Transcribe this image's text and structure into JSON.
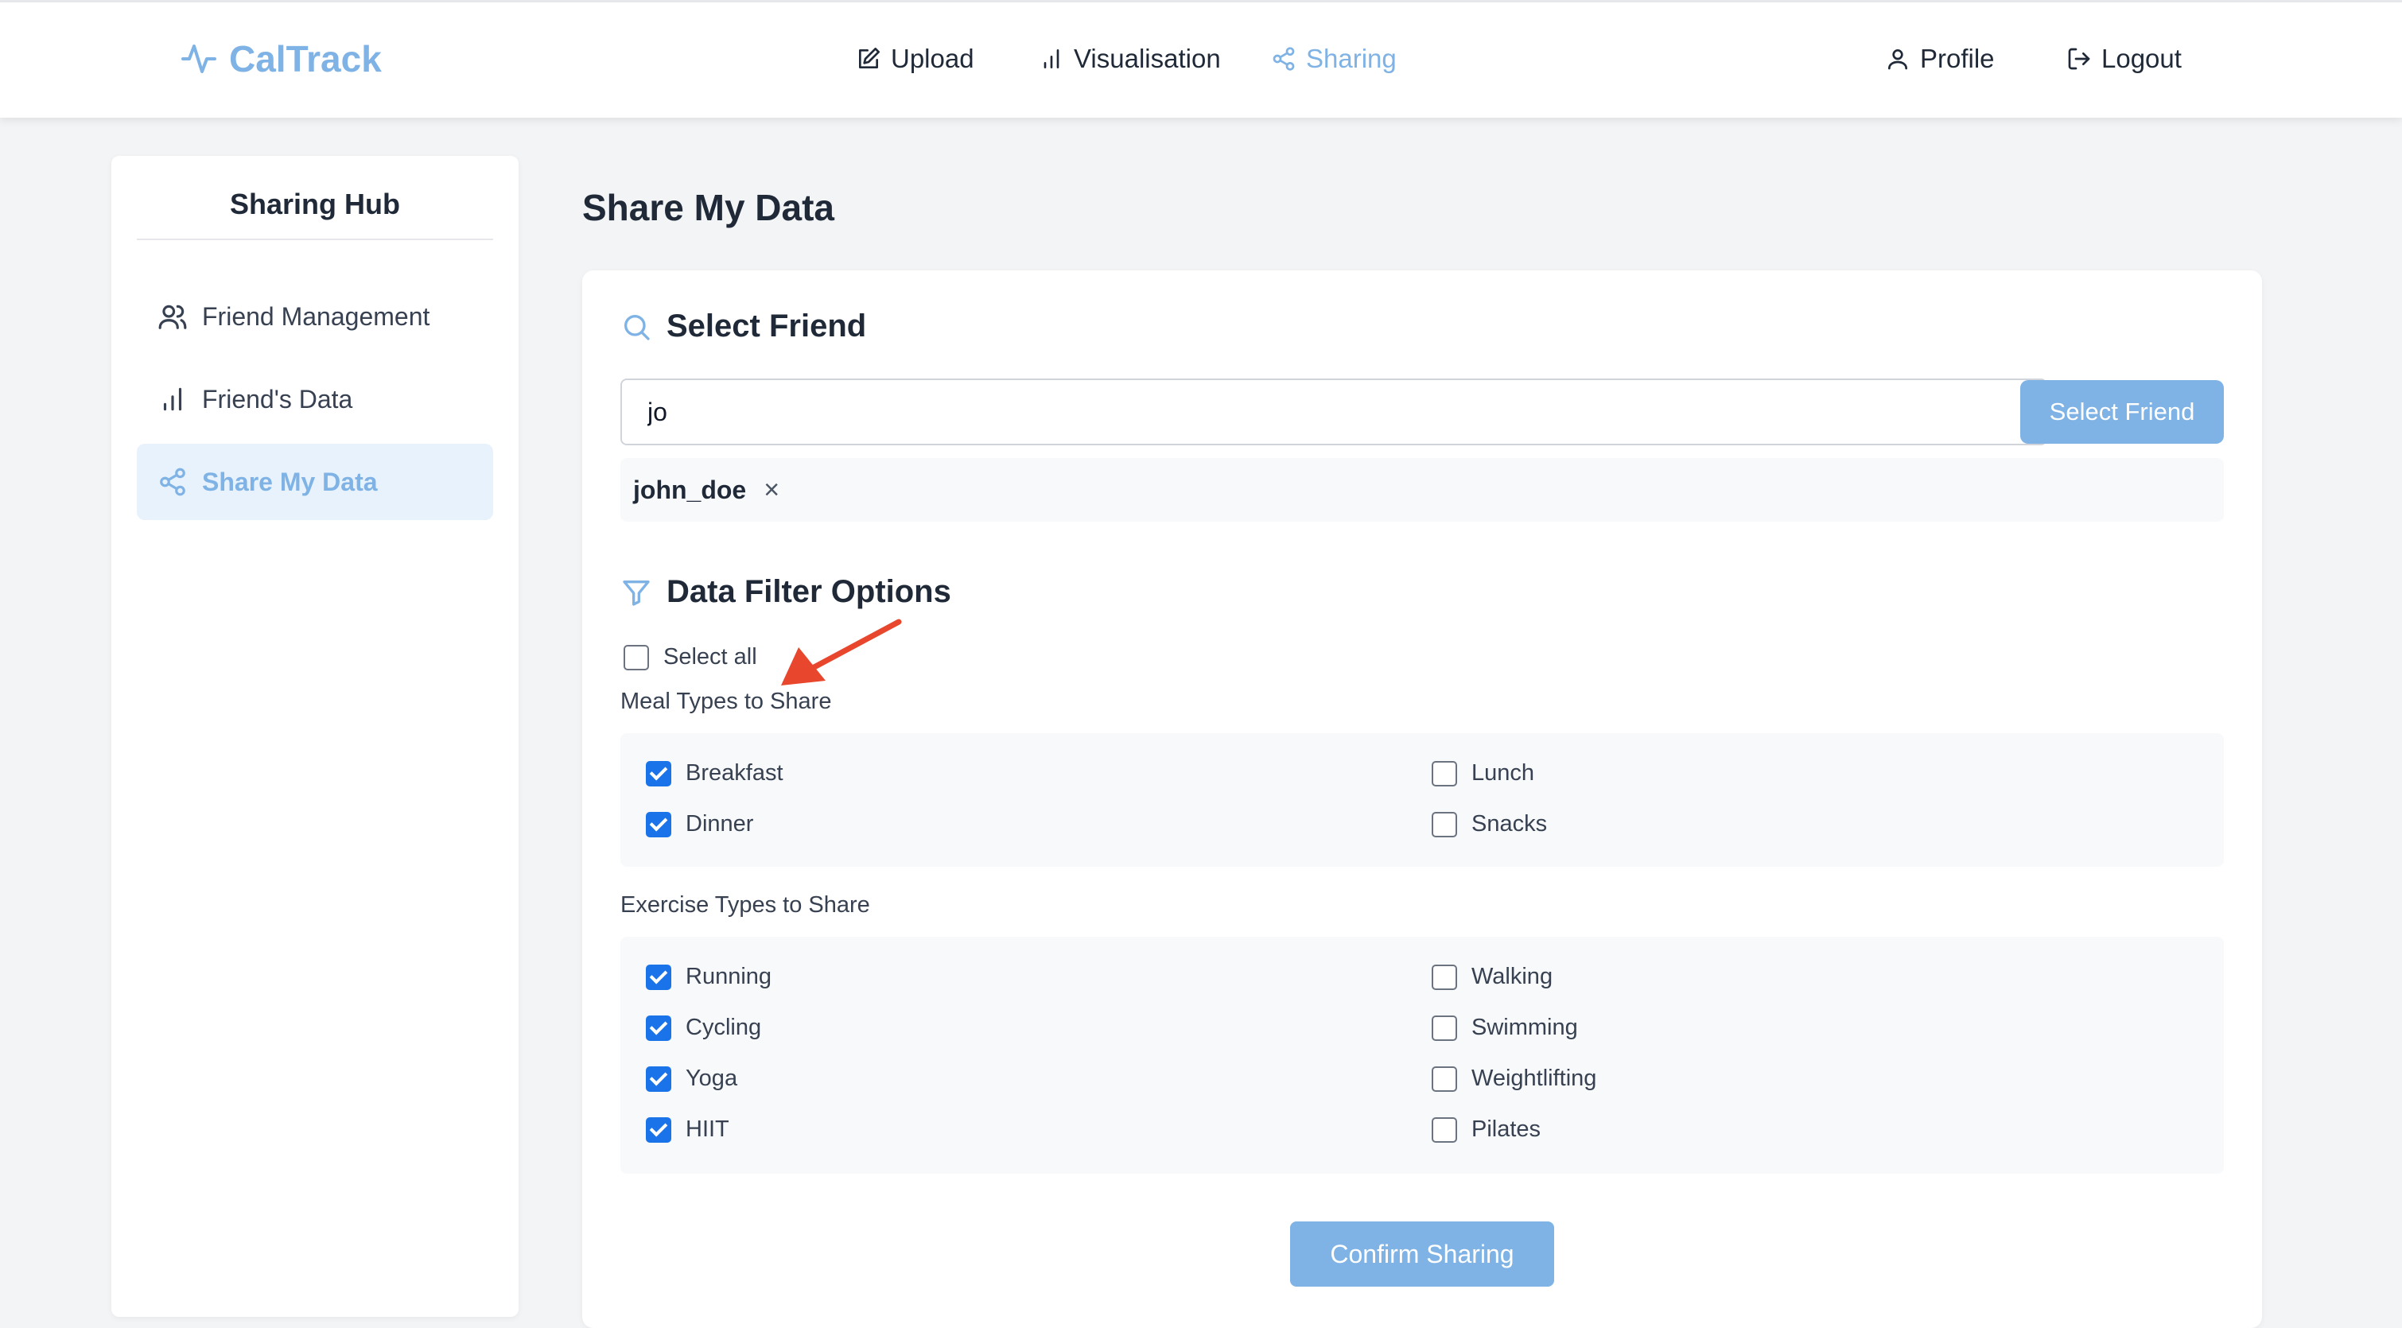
{
  "app": {
    "name": "CalTrack",
    "accent": "#7fb2e5"
  },
  "nav": {
    "upload": "Upload",
    "visualisation": "Visualisation",
    "sharing": "Sharing",
    "profile": "Profile",
    "logout": "Logout"
  },
  "sidebar": {
    "title": "Sharing Hub",
    "items": [
      {
        "label": "Friend Management",
        "icon": "users-icon"
      },
      {
        "label": "Friend's Data",
        "icon": "bar-chart-icon"
      },
      {
        "label": "Share My Data",
        "icon": "share-icon",
        "active": true
      }
    ]
  },
  "main": {
    "title": "Share My Data",
    "select_friend": {
      "heading": "Select Friend",
      "search_value": "jo",
      "button_label": "Select Friend",
      "selected_friend": "john_doe",
      "remove_glyph": "×"
    },
    "filters": {
      "heading": "Data Filter Options",
      "select_all_label": "Select all",
      "select_all_checked": false,
      "meal_group_label": "Meal Types to Share",
      "meals": [
        {
          "label": "Breakfast",
          "checked": true
        },
        {
          "label": "Lunch",
          "checked": false
        },
        {
          "label": "Dinner",
          "checked": true
        },
        {
          "label": "Snacks",
          "checked": false
        }
      ],
      "exercise_group_label": "Exercise Types to Share",
      "exercises": [
        {
          "label": "Running",
          "checked": true
        },
        {
          "label": "Walking",
          "checked": false
        },
        {
          "label": "Cycling",
          "checked": true
        },
        {
          "label": "Swimming",
          "checked": false
        },
        {
          "label": "Yoga",
          "checked": true
        },
        {
          "label": "Weightlifting",
          "checked": false
        },
        {
          "label": "HIIT",
          "checked": true
        },
        {
          "label": "Pilates",
          "checked": false
        }
      ]
    },
    "confirm_label": "Confirm Sharing"
  },
  "annotation": {
    "arrow_color": "#e8472e"
  }
}
